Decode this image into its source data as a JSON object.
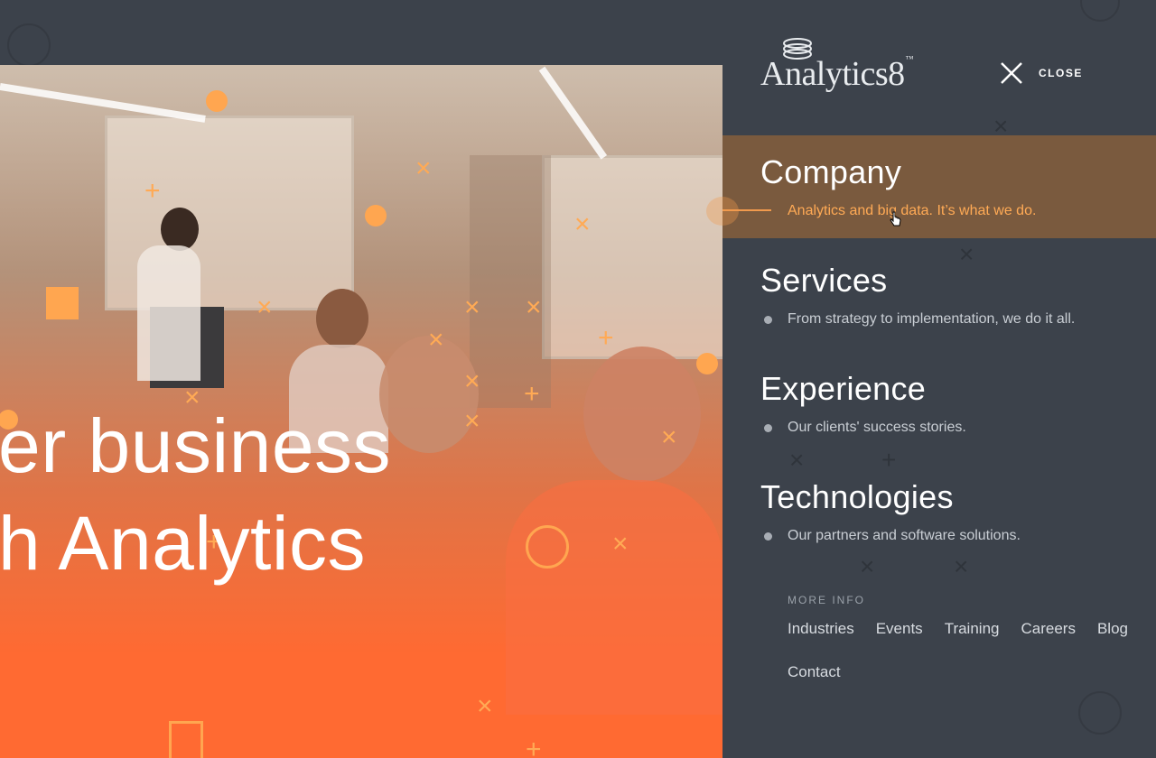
{
  "brand": {
    "name": "Analytics8",
    "tm": "™"
  },
  "close": {
    "label": "CLOSE"
  },
  "hero": {
    "line1": "er business",
    "line2": "h Analytics"
  },
  "nav": [
    {
      "title": "Company",
      "desc": "Analytics and big data. It’s what we do.",
      "active": true
    },
    {
      "title": "Services",
      "desc": "From strategy to implementation, we do it all.",
      "active": false
    },
    {
      "title": "Experience",
      "desc": "Our clients' success stories.",
      "active": false
    },
    {
      "title": "Technologies",
      "desc": "Our partners and software solutions.",
      "active": false
    }
  ],
  "more_info": {
    "label": "MORE INFO",
    "links": [
      "Industries",
      "Events",
      "Training",
      "Careers",
      "Blog",
      "Contact"
    ]
  },
  "colors": {
    "accent": "#f19a4d",
    "panel": "#3c424b",
    "active_bg": "#7a5a3e",
    "hero_orange": "#ff6a32"
  },
  "icons": [
    "close-icon",
    "logo-mark-icon",
    "pointer-cursor-icon"
  ]
}
